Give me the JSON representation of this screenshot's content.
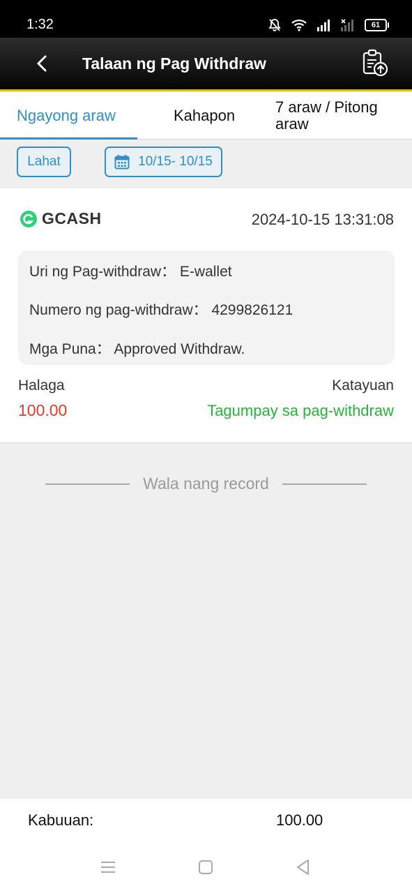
{
  "status_bar": {
    "time": "1:32",
    "battery": "61",
    "icons": [
      "bell-off-icon",
      "wifi-icon",
      "signal-icon",
      "signal-no-service-icon",
      "battery-icon"
    ]
  },
  "header": {
    "title": "Talaan ng Pag Withdraw",
    "back_icon": "chevron-left-icon",
    "action_icon": "clipboard-export-icon"
  },
  "tabs": [
    {
      "label": "Ngayong araw",
      "active": true
    },
    {
      "label": "Kahapon",
      "active": false
    },
    {
      "label": "7 araw / Pitong araw",
      "active": false
    }
  ],
  "filters": {
    "all_label": "Lahat",
    "date_range": "10/15- 10/15",
    "date_icon": "calendar-icon"
  },
  "records": [
    {
      "method": "GCASH",
      "datetime": "2024-10-15 13:31:08",
      "type_label": "Uri ng Pag-withdraw：",
      "type_value": "E-wallet",
      "number_label": "Numero ng pag-withdraw：",
      "number_value": "4299826121",
      "remarks_label": "Mga Puna：",
      "remarks_value": "Approved Withdraw.",
      "amount_label": "Halaga",
      "amount": "100.00",
      "status_label": "Katayuan",
      "status": "Tagumpay sa pag-withdraw"
    }
  ],
  "no_more_text": "Wala nang record",
  "footer": {
    "total_label": "Kabuuan:",
    "total_value": "100.00"
  },
  "colors": {
    "accent": "#2e8fc9",
    "amount": "#e03b2c",
    "success": "#28b33b",
    "header_border": "#e8b400",
    "gcash": "#2fd07c"
  }
}
